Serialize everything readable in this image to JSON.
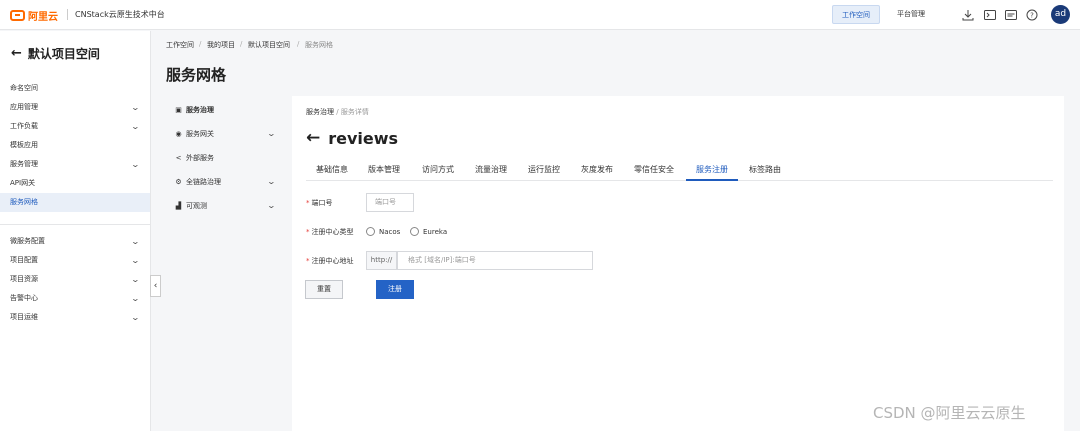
{
  "header": {
    "logo_text": "阿里云",
    "product_name": "CNStack云原生技术中台",
    "nav_work": "工作空间",
    "nav_platform": "平台管理",
    "avatar_text": "ad",
    "accent_color": "#1f5bbd",
    "brand_color": "#ff6a00",
    "icons": [
      "download-icon",
      "terminal-icon",
      "yaml-icon",
      "help-icon"
    ]
  },
  "sidebar": {
    "back_title": "默认项目空间",
    "items": [
      {
        "label": "命名空间"
      },
      {
        "label": "应用管理"
      },
      {
        "label": "工作负载"
      },
      {
        "label": "模板应用"
      },
      {
        "label": "服务管理"
      },
      {
        "label": "API网关"
      },
      {
        "label": "服务网格"
      },
      {
        "label": "微服务配置"
      },
      {
        "label": "项目配置"
      },
      {
        "label": "项目资源"
      },
      {
        "label": "告警中心"
      },
      {
        "label": "项目运维"
      }
    ]
  },
  "breadcrumb": [
    "工作空间",
    "我的项目",
    "默认项目空间",
    "服务网格"
  ],
  "page_title": "服务网格",
  "subnav": [
    {
      "label": "服务治理",
      "icon": "governance-icon"
    },
    {
      "label": "服务网关",
      "icon": "gateway-icon"
    },
    {
      "label": "外部服务",
      "icon": "share-icon"
    },
    {
      "label": "全链路治理",
      "icon": "tracing-icon"
    },
    {
      "label": "可观测",
      "icon": "chart-icon"
    }
  ],
  "detail": {
    "crumb_parent": "服务治理",
    "crumb_sep": "/",
    "crumb_current": "服务详情",
    "title": "reviews",
    "tabs": [
      "基础信息",
      "版本管理",
      "访问方式",
      "流量治理",
      "运行监控",
      "灰度发布",
      "零信任安全",
      "服务注册",
      "标签路由"
    ],
    "active_tab": "服务注册"
  },
  "form": {
    "port_label": "端口号",
    "port_placeholder": "端口号",
    "registry_type_label": "注册中心类型",
    "registry_options": [
      "Nacos",
      "Eureka"
    ],
    "registry_addr_label": "注册中心地址",
    "addr_prefix": "http://",
    "addr_placeholder": "格式 [域名/IP]:端口号",
    "reset_label": "重置",
    "submit_label": "注册"
  },
  "watermark": "CSDN @阿里云云原生"
}
